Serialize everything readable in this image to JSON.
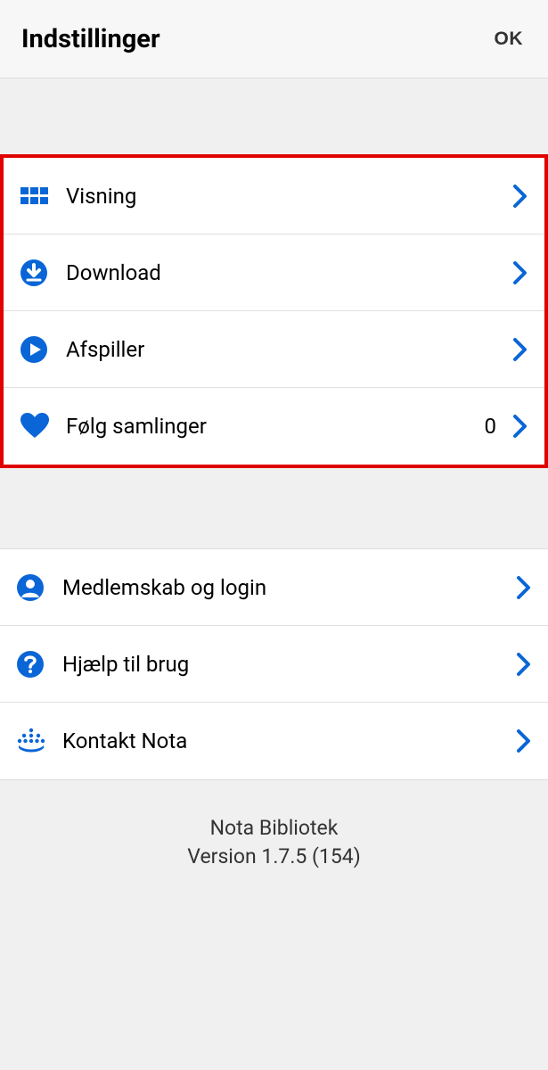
{
  "header": {
    "title": "Indstillinger",
    "ok": "OK"
  },
  "group1": [
    {
      "icon": "grid",
      "label": "Visning"
    },
    {
      "icon": "download",
      "label": "Download"
    },
    {
      "icon": "play",
      "label": "Afspiller"
    },
    {
      "icon": "heart",
      "label": "Følg samlinger",
      "value": "0"
    }
  ],
  "group2": [
    {
      "icon": "person",
      "label": "Medlemskab og login"
    },
    {
      "icon": "help",
      "label": "Hjælp til brug"
    },
    {
      "icon": "crown",
      "label": "Kontakt Nota"
    }
  ],
  "footer": {
    "line1": "Nota Bibliotek",
    "line2": "Version 1.7.5 (154)"
  },
  "colors": {
    "accent": "#0a66d6"
  }
}
